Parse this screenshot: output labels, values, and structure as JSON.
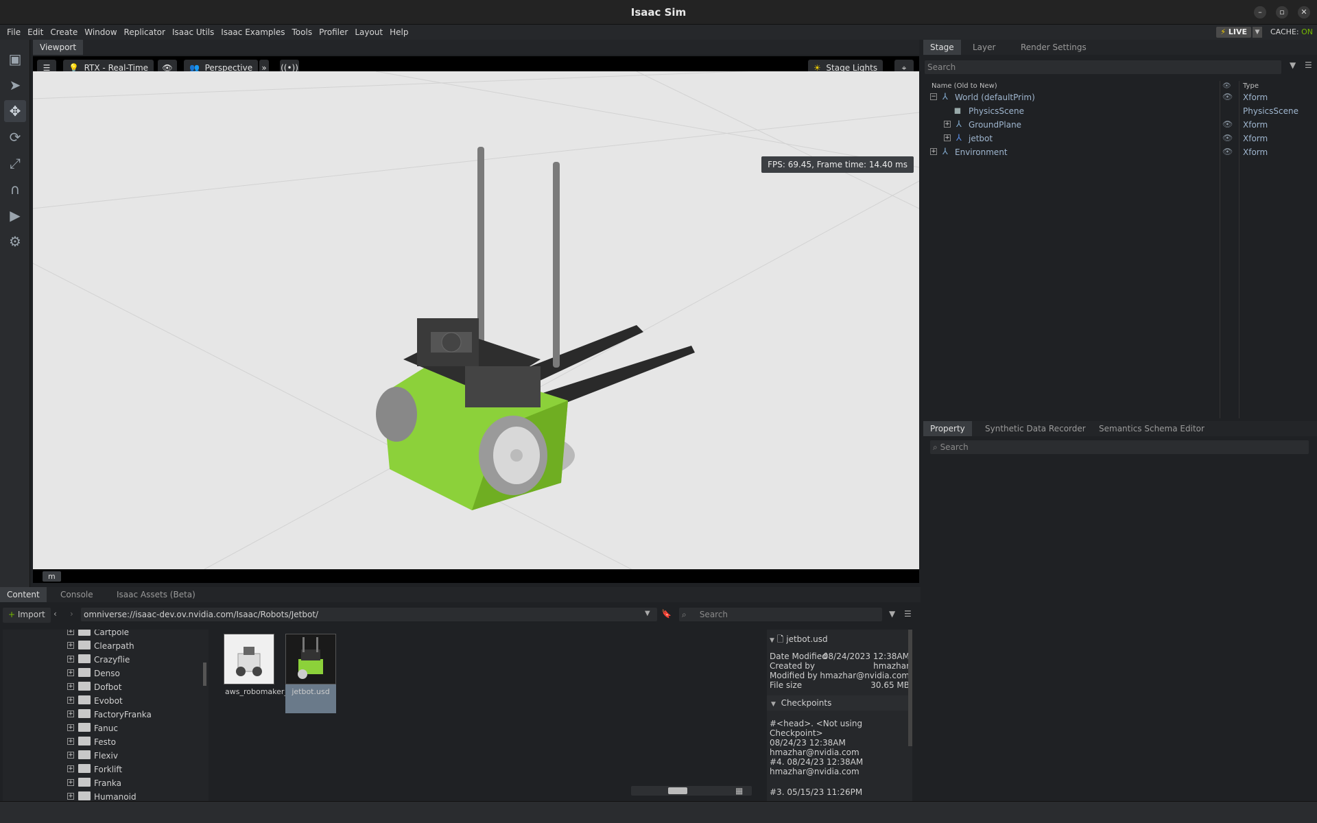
{
  "window": {
    "title": "Isaac Sim"
  },
  "menu": [
    "File",
    "Edit",
    "Create",
    "Window",
    "Replicator",
    "Isaac Utils",
    "Isaac Examples",
    "Tools",
    "Profiler",
    "Layout",
    "Help"
  ],
  "live": {
    "label": "LIVE",
    "cache_label": "CACHE:",
    "cache_state": "ON"
  },
  "viewport": {
    "tab": "Viewport",
    "renderer": "RTX - Real-Time",
    "camera": "Perspective",
    "lights": "Stage Lights",
    "fps": "FPS: 69.45, Frame time: 14.40 ms",
    "unit": "m"
  },
  "stage": {
    "tabs": [
      "Stage",
      "Layer",
      "Render Settings"
    ],
    "search_placeholder": "Search",
    "col_name": "Name (Old to New)",
    "col_type": "Type",
    "rows": [
      {
        "name": "World (defaultPrim)",
        "type": "Xform"
      },
      {
        "name": "PhysicsScene",
        "type": "PhysicsScene"
      },
      {
        "name": "GroundPlane",
        "type": "Xform"
      },
      {
        "name": "jetbot",
        "type": "Xform"
      },
      {
        "name": "Environment",
        "type": "Xform"
      }
    ]
  },
  "property": {
    "tabs": [
      "Property",
      "Synthetic Data Recorder",
      "Semantics Schema Editor"
    ],
    "search_placeholder": "Search"
  },
  "content": {
    "tabs": [
      "Content",
      "Console",
      "Isaac Assets (Beta)"
    ],
    "import_label": "Import",
    "path": "omniverse://isaac-dev.ov.nvidia.com/Isaac/Robots/Jetbot/",
    "search_placeholder": "Search",
    "folders": [
      "Cartpole",
      "Clearpath",
      "Crazyflie",
      "Denso",
      "Dofbot",
      "Evobot",
      "FactoryFranka",
      "Fanuc",
      "Festo",
      "Flexiv",
      "Forklift",
      "Franka",
      "Humanoid"
    ],
    "files": [
      {
        "label": "aws_robomaker_je...t.usd"
      },
      {
        "label": "jetbot.usd"
      }
    ],
    "info": {
      "filename": "jetbot.usd",
      "date_modified_label": "Date Modified",
      "date_modified": "08/24/2023 12:38AM",
      "created_by_label": "Created by",
      "created_by": "hmazhar",
      "modified_by_label": "Modified by",
      "modified_by": "hmazhar@nvidia.com",
      "file_size_label": "File size",
      "file_size": "30.65 MB",
      "checkpoints_label": "Checkpoints",
      "checkpoints": [
        {
          "line1": "#<head>.   <Not using Checkpoint>",
          "line2": "08/24/23 12:38AM",
          "line3": "hmazhar@nvidia.com"
        },
        {
          "line1": "#4.   08/24/23 12:38AM",
          "line2": "hmazhar@nvidia.com",
          "line3": ""
        },
        {
          "line1": "#3.   05/15/23 11:26PM",
          "line2": "",
          "line3": ""
        }
      ]
    }
  },
  "colors": {
    "accent_green": "#76b900",
    "panel_bg": "#1f2124",
    "tree_text": "#9fb6cf"
  }
}
